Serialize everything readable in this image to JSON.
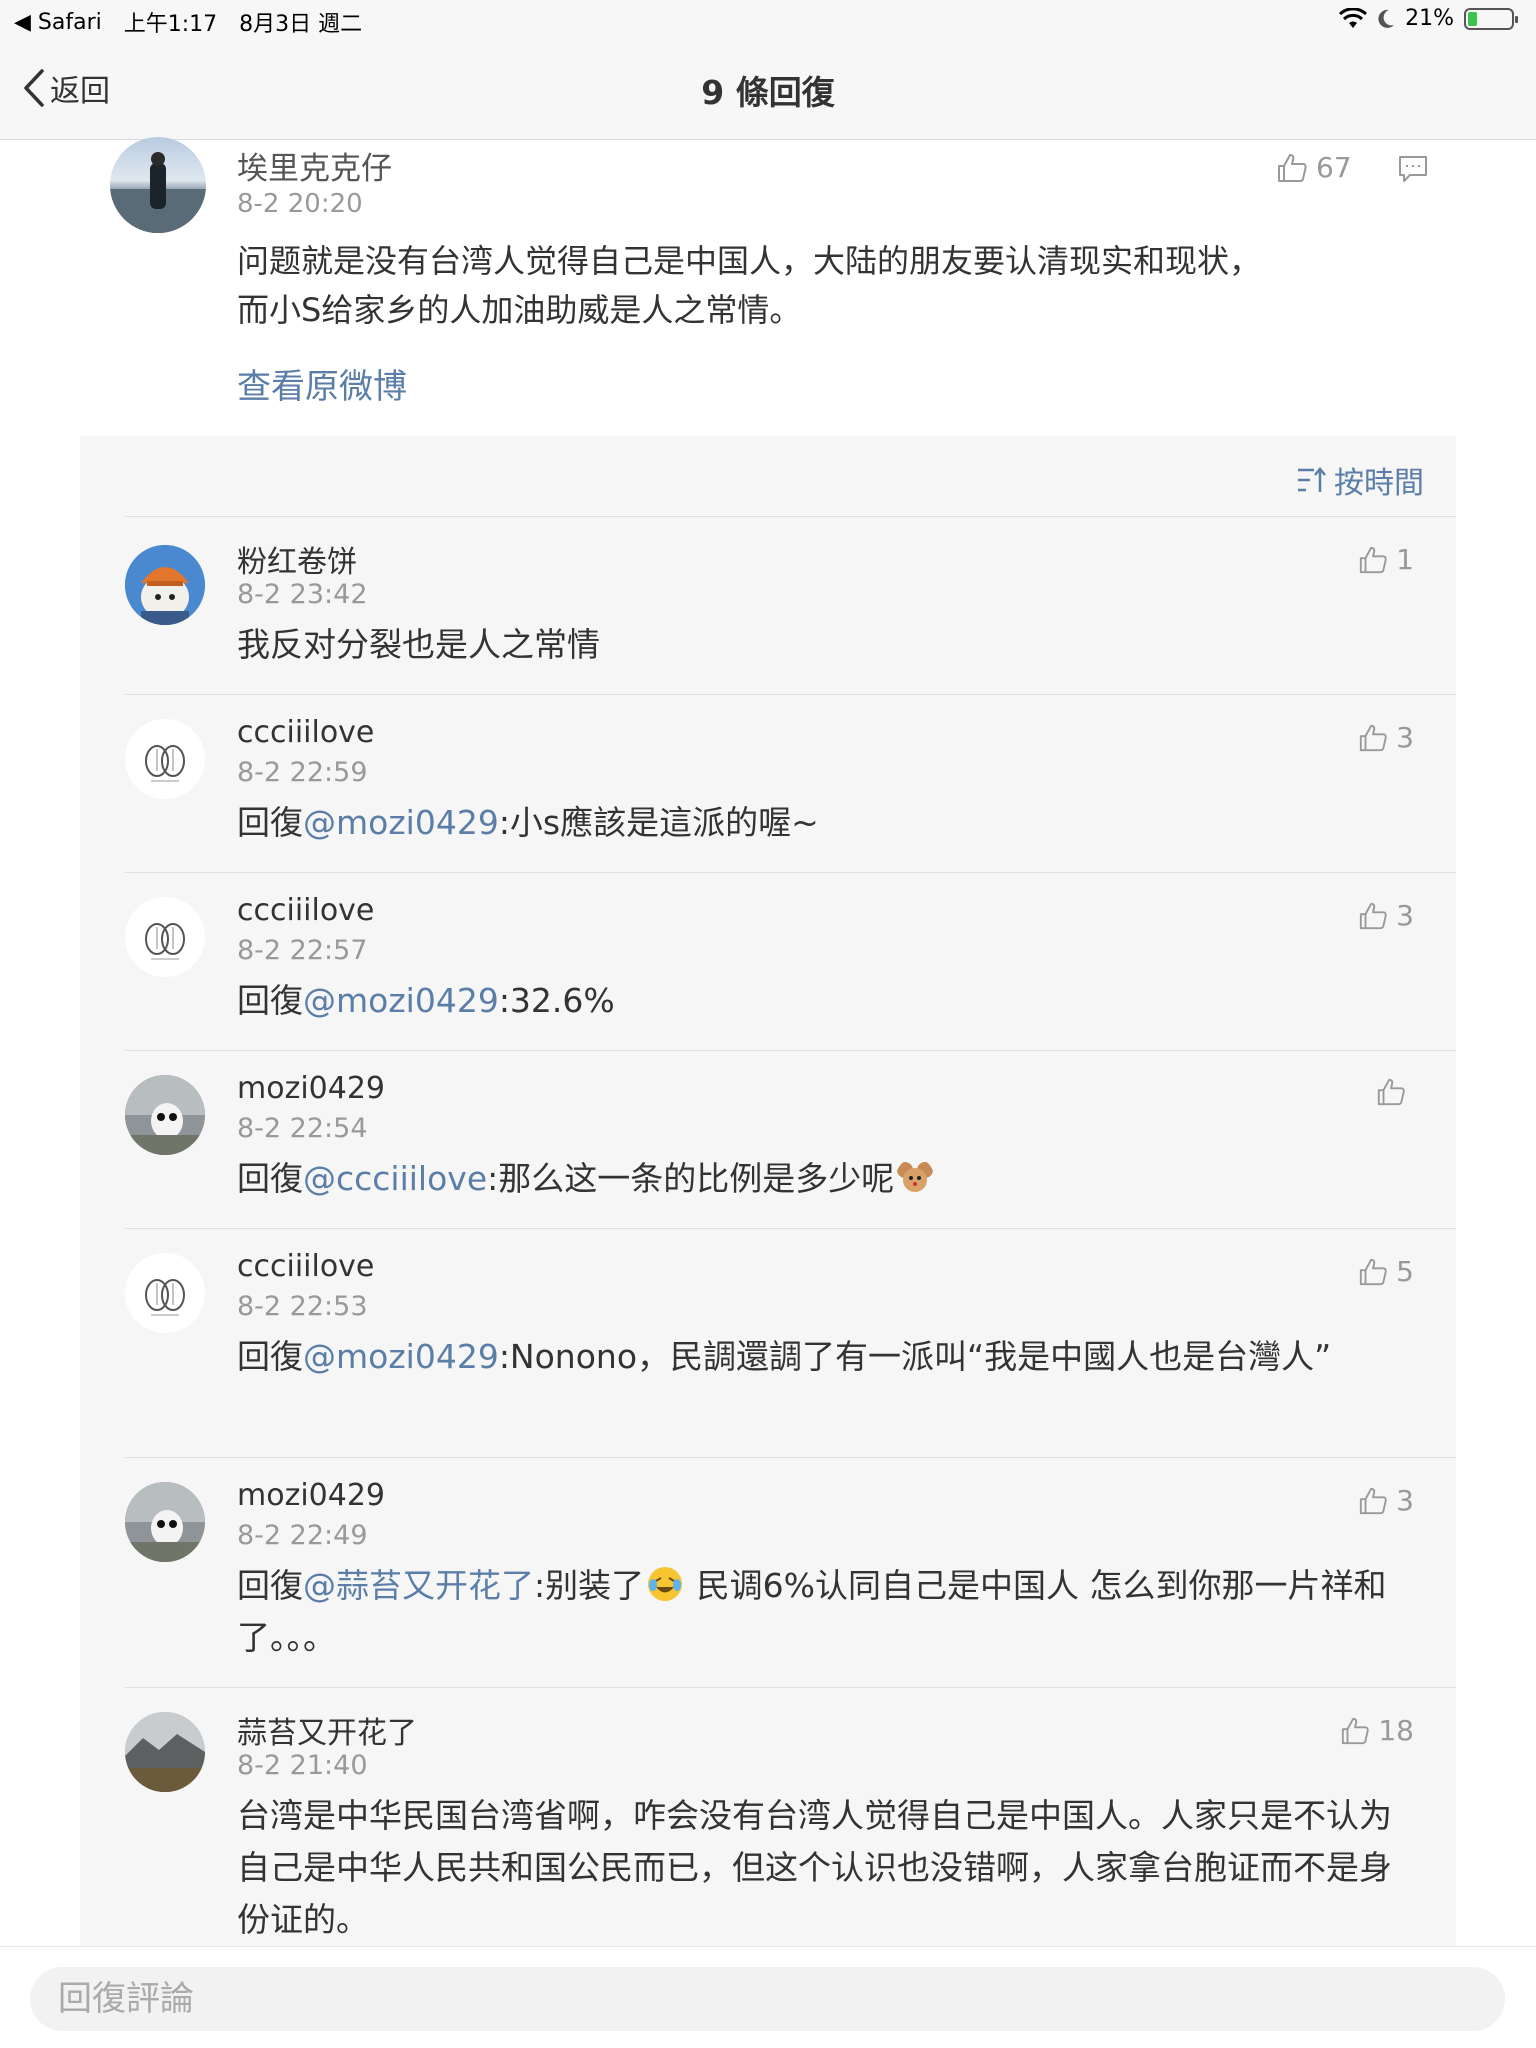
{
  "status_bar": {
    "back_app": "Safari",
    "time": "上午1:17",
    "date": "8月3日 週二",
    "battery": "21%",
    "battery_level": 0.21
  },
  "nav": {
    "back_label": "返回",
    "title": "9 條回復"
  },
  "main_comment": {
    "author": "埃里克克仔",
    "time": "8-2 20:20",
    "likes": "67",
    "text_line1": "问题就是没有台湾人觉得自己是中国人，大陆的朋友要认清现实和现状，",
    "text_line2": "而小S给家乡的人加油助威是人之常情。",
    "view_original": "查看原微博"
  },
  "sort_label": "按時間",
  "replies": [
    {
      "author": "粉红卷饼",
      "time": "8-2 23:42",
      "likes": "1",
      "prefix": "",
      "mention": "",
      "text": "我反对分裂也是人之常情"
    },
    {
      "author": "ccciiilove",
      "time": "8-2 22:59",
      "likes": "3",
      "prefix": "回復",
      "mention": "@mozi0429",
      "text": ":小s應該是這派的喔~"
    },
    {
      "author": "ccciiilove",
      "time": "8-2 22:57",
      "likes": "3",
      "prefix": "回復",
      "mention": "@mozi0429",
      "text": ":32.6%"
    },
    {
      "author": "mozi0429",
      "time": "8-2 22:54",
      "likes": "",
      "prefix": "回復",
      "mention": "@ccciiilove",
      "text": ":那么这一条的比例是多少呢"
    },
    {
      "author": "ccciiilove",
      "time": "8-2 22:53",
      "likes": "5",
      "prefix": "回復",
      "mention": "@mozi0429",
      "text": ":Nonono，民調還調了有一派叫“我是中國人也是台灣人”"
    },
    {
      "author": "mozi0429",
      "time": "8-2 22:49",
      "likes": "3",
      "prefix": "回復",
      "mention": "@蒜苔又开花了",
      "text": ":别装了",
      "text2": " 民调6%认同自己是中国人 怎么到你那一片祥和了。。。"
    },
    {
      "author": "蒜苔又开花了",
      "time": "8-2 21:40",
      "likes": "18",
      "prefix": "",
      "mention": "",
      "text": "台湾是中华民国台湾省啊，咋会没有台湾人觉得自己是中国人。人家只是不认为自己是中华人民共和国公民而已，但这个认识也没错啊，人家拿台胞证而不是身份证的。"
    }
  ],
  "input": {
    "placeholder": "回復評論"
  },
  "icons": [
    "wifi-icon",
    "moon-icon",
    "battery-icon",
    "chevron-left-icon",
    "thumbs-up-icon",
    "comment-icon",
    "sort-icon"
  ],
  "colors": {
    "link": "#5b7ea8",
    "panel_bg": "#f6f6f6",
    "secondary_text": "#999999"
  }
}
